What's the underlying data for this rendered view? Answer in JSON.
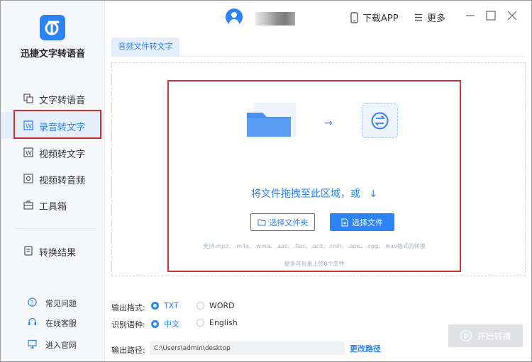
{
  "app": {
    "name": "迅捷文字转语音"
  },
  "sidebar": {
    "items": [
      {
        "label": "文字转语音",
        "icon": "text-to-speech-icon"
      },
      {
        "label": "录音转文字",
        "icon": "recording-to-text-icon",
        "active": true
      },
      {
        "label": "视频转文字",
        "icon": "video-to-text-icon"
      },
      {
        "label": "视频转音频",
        "icon": "video-to-audio-icon"
      },
      {
        "label": "工具箱",
        "icon": "toolbox-icon"
      },
      {
        "label": "转换结果",
        "icon": "results-icon"
      }
    ],
    "help": [
      {
        "label": "常见问题",
        "icon": "question-icon"
      },
      {
        "label": "在线客服",
        "icon": "headset-icon"
      },
      {
        "label": "进入官网",
        "icon": "monitor-icon"
      }
    ]
  },
  "topbar": {
    "download_app": "下载APP",
    "more": "更多"
  },
  "tab": {
    "label": "音频文件转文字"
  },
  "dropzone": {
    "hint": "将文件拖拽至此区域，或",
    "choose_folder": "选择文件夹",
    "choose_file": "选择文件",
    "supported": "支持.mp3、.m4a、.wma、.aac、.flac、.ac3、.m4r、.ape、.ogg、.wav格式的转换",
    "max_files": "最多可批量上传8个文件"
  },
  "options": {
    "format_label": "输出格式:",
    "format_options": [
      "TXT",
      "WORD"
    ],
    "format_selected": "TXT",
    "language_label": "识别语种:",
    "language_options": [
      "中文",
      "English"
    ],
    "language_selected": "中文",
    "path_label": "输出路径:",
    "path_value": "C:\\Users\\admin\\desktop",
    "change_path": "更改路径"
  },
  "start_button": "开始转换",
  "colors": {
    "accent": "#2b83f6",
    "highlight_outline": "#d22b2b",
    "disabled": "#dfe1e5"
  }
}
